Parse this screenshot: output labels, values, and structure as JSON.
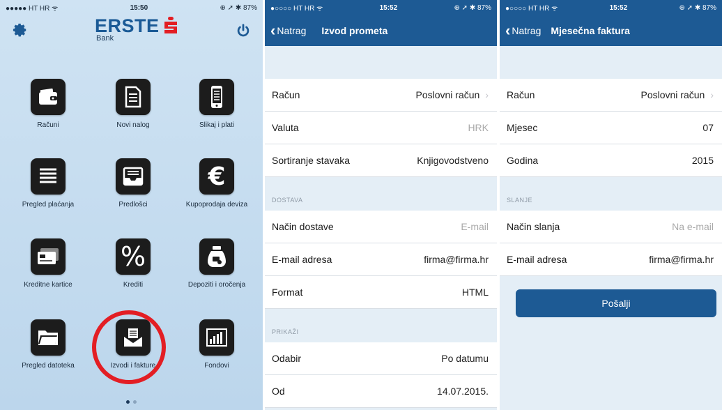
{
  "home": {
    "status": {
      "carrier": "●●●●● HT HR ᯤ",
      "time": "15:50",
      "battery": "⊕ ➚ ✱ 87%"
    },
    "brand": {
      "name": "ERSTE",
      "sub": "Bank"
    },
    "tiles": [
      {
        "label": "Računi",
        "icon": "wallet-icon"
      },
      {
        "label": "Novi nalog",
        "icon": "document-icon"
      },
      {
        "label": "Slikaj i plati",
        "icon": "phone-icon"
      },
      {
        "label": "Pregled plaćanja",
        "icon": "list-icon"
      },
      {
        "label": "Predlošci",
        "icon": "inbox-tray-icon"
      },
      {
        "label": "Kupoprodaja deviza",
        "icon": "euro-icon"
      },
      {
        "label": "Kreditne kartice",
        "icon": "credit-card-icon"
      },
      {
        "label": "Krediti",
        "icon": "percent-icon"
      },
      {
        "label": "Depoziti i oročenja",
        "icon": "money-bag-icon"
      },
      {
        "label": "Pregled datoteka",
        "icon": "folder-icon"
      },
      {
        "label": "Izvodi i fakture",
        "icon": "envelope-icon"
      },
      {
        "label": "Fondovi",
        "icon": "bar-chart-icon"
      }
    ],
    "highlight_color": "#e31e24"
  },
  "statement": {
    "status": {
      "carrier": "●○○○○ HT HR ᯤ",
      "time": "15:52",
      "battery": "⊕ ➚ ✱ 87%"
    },
    "back_label": "Natrag",
    "title": "Izvod prometa",
    "rows_top": [
      {
        "label": "Račun",
        "value": "Poslovni račun",
        "chevron": true,
        "muted": false
      },
      {
        "label": "Valuta",
        "value": "HRK",
        "chevron": false,
        "muted": true
      },
      {
        "label": "Sortiranje stavaka",
        "value": "Knjigovodstveno",
        "chevron": false,
        "muted": false
      }
    ],
    "section_delivery": "DOSTAVA",
    "rows_delivery": [
      {
        "label": "Način dostave",
        "value": "E-mail",
        "muted": true
      },
      {
        "label": "E-mail adresa",
        "value": "firma@firma.hr",
        "muted": false
      },
      {
        "label": "Format",
        "value": "HTML",
        "muted": false
      }
    ],
    "section_show": "PRIKAŽI",
    "rows_show": [
      {
        "label": "Odabir",
        "value": "Po datumu"
      },
      {
        "label": "Od",
        "value": "14.07.2015."
      }
    ]
  },
  "invoice": {
    "status": {
      "carrier": "●○○○○ HT HR ᯤ",
      "time": "15:52",
      "battery": "⊕ ➚ ✱ 87%"
    },
    "back_label": "Natrag",
    "title": "Mjesečna faktura",
    "rows_top": [
      {
        "label": "Račun",
        "value": "Poslovni račun",
        "chevron": true
      },
      {
        "label": "Mjesec",
        "value": "07",
        "chevron": false
      },
      {
        "label": "Godina",
        "value": "2015",
        "chevron": false
      }
    ],
    "section_send": "SLANJE",
    "rows_send": [
      {
        "label": "Način slanja",
        "value": "Na e-mail",
        "muted": true
      },
      {
        "label": "E-mail adresa",
        "value": "firma@firma.hr",
        "muted": false
      }
    ],
    "send_button": "Pošalji"
  },
  "colors": {
    "accent": "#1d5a94",
    "brand_red": "#e31e24"
  }
}
